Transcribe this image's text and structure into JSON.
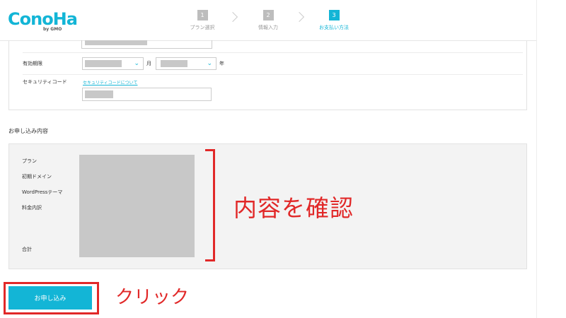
{
  "header": {
    "logo_text": "ConoHa",
    "logo_sub": "by GMO",
    "steps": [
      {
        "num": "1",
        "label": "プラン選択"
      },
      {
        "num": "2",
        "label": "情報入力"
      },
      {
        "num": "3",
        "label": "お支払い方法"
      }
    ],
    "active_step": 3
  },
  "payment": {
    "expiry_label": "有効期限",
    "month_suffix": "月",
    "year_suffix": "年",
    "security_label": "セキュリティコード",
    "security_link": "セキュリティコードについて"
  },
  "summary": {
    "title": "お申し込み内容",
    "rows": [
      "プラン",
      "初期ドメイン",
      "WordPressテーマ",
      "料金内訳",
      "合計"
    ]
  },
  "annotations": {
    "confirm": "内容を確認",
    "click": "クリック"
  },
  "submit_label": "お申し込み",
  "colors": {
    "accent": "#13b5d6",
    "annotation_red": "#e12828",
    "mask_gray": "#c8c8c8"
  }
}
